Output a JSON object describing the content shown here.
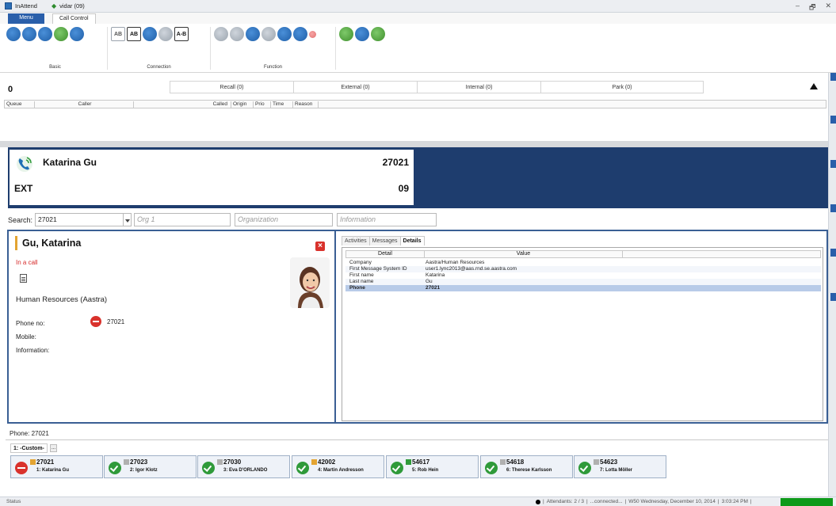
{
  "window": {
    "app_title": "InAttend",
    "user": "vidar (09)",
    "controls": [
      "–",
      "🗗",
      "✕"
    ]
  },
  "ribbon": {
    "tabs": [
      "Menu",
      "Call Control"
    ],
    "groups": [
      "Basic",
      "Connection",
      "Function"
    ]
  },
  "queue": {
    "count": "0",
    "tabs": [
      "Recall (0)",
      "External (0)",
      "Internal (0)",
      "Park (0)"
    ],
    "columns": [
      "Queue",
      "Caller",
      "Called",
      "Origin",
      "Prio",
      "Time",
      "Reason"
    ]
  },
  "call": {
    "name": "Katarina Gu",
    "number": "27021",
    "type": "EXT",
    "ext": "09"
  },
  "search": {
    "label": "Search:",
    "value": "27021",
    "org_placeholder": "Org 1",
    "organization_placeholder": "Organization",
    "information_placeholder": "Information"
  },
  "contact": {
    "name": "Gu, Katarina",
    "status": "In a call",
    "department": "Human Resources (Aastra)",
    "phone_label": "Phone no:",
    "phone": "27021",
    "mobile_label": "Mobile:",
    "information_label": "Information:"
  },
  "info": {
    "tabs": [
      "Activities",
      "Messages",
      "Details"
    ],
    "columns": [
      "Detail",
      "Value"
    ],
    "rows": [
      {
        "detail": "Company",
        "value": "Aastra/Human Resources"
      },
      {
        "detail": "First Message System ID",
        "value": "user1.lync2013@aas.rnd.se.aastra.com"
      },
      {
        "detail": "First name",
        "value": "Katarina"
      },
      {
        "detail": "Last name",
        "value": "Gu"
      },
      {
        "detail": "Phone",
        "value": "27021"
      }
    ]
  },
  "phone_panel": {
    "label": "Phone: 27021",
    "tab": "1: -Custom-",
    "more": "..."
  },
  "speed_dials": [
    {
      "number": "27021",
      "name": "1: Katarina Gu",
      "state": "busy",
      "square": "#e3a432"
    },
    {
      "number": "27023",
      "name": "2: Igor Klotz",
      "state": "ok",
      "square": "#b0b0b0"
    },
    {
      "number": "27030",
      "name": "3: Eva D'ORLANDO",
      "state": "ok",
      "square": "#b0b0b0"
    },
    {
      "number": "42002",
      "name": "4: Martin Andresson",
      "state": "ok",
      "square": "#e3a432"
    },
    {
      "number": "54617",
      "name": "5: Rob Hein",
      "state": "ok",
      "square": "#2f9a3a"
    },
    {
      "number": "54618",
      "name": "6: Therese Karlsson",
      "state": "ok",
      "square": "#b0b0b0"
    },
    {
      "number": "54623",
      "name": "7: Lotta Möller",
      "state": "ok",
      "square": "#b0b0b0"
    }
  ],
  "statusbar": {
    "status": "Status",
    "attendants": "Attendants: 2 / 3",
    "connection": "...connected...",
    "datetime": "W50 Wednesday, December 10, 2014",
    "time": "3:03:24 PM"
  },
  "colors": {
    "accent": "#1e3d6e",
    "busy": "#d9322c",
    "available": "#2f9a3a"
  }
}
